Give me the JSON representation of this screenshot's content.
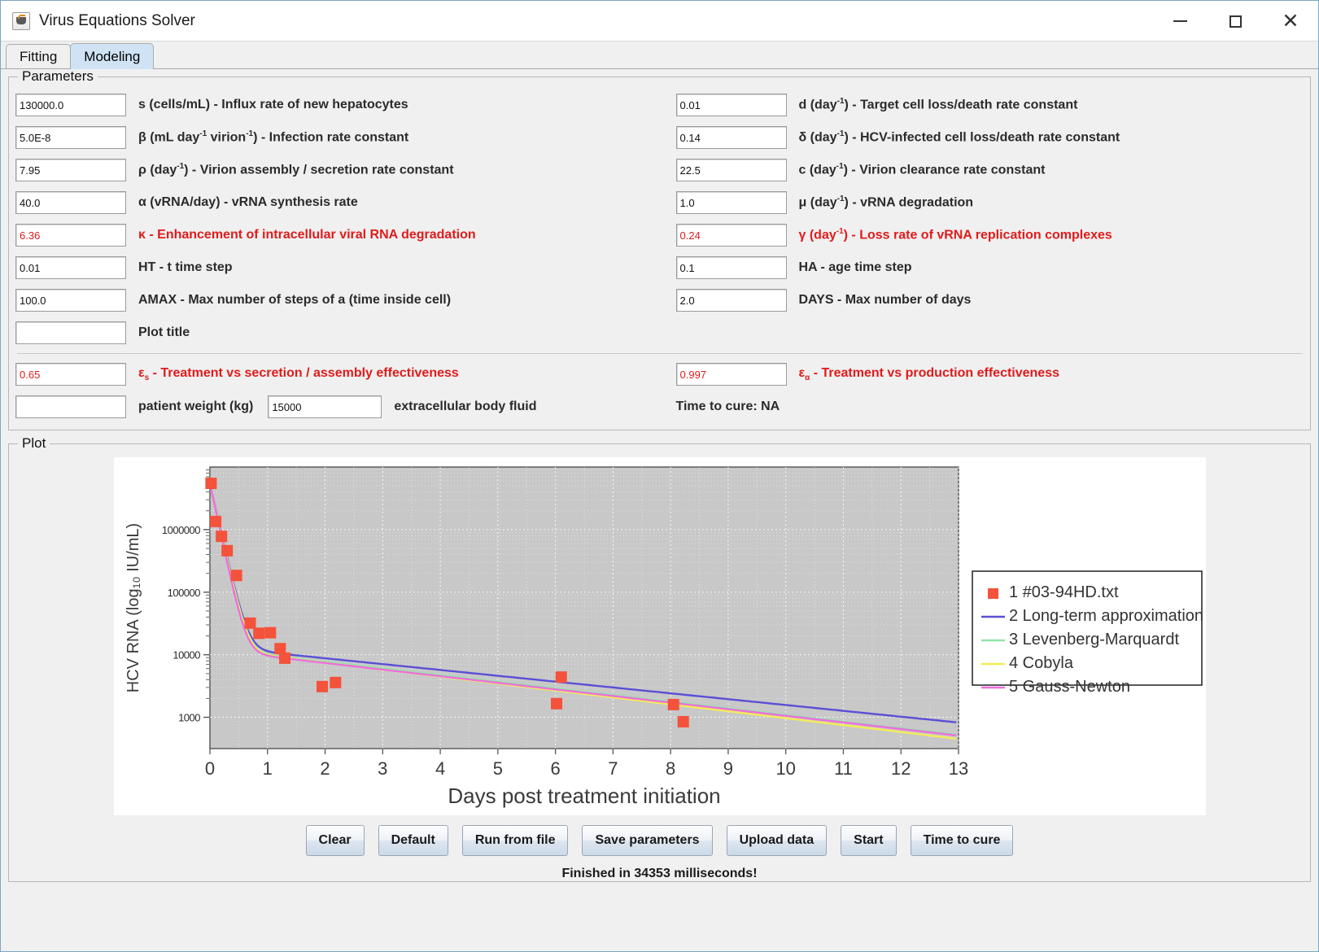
{
  "window": {
    "title": "Virus Equations Solver",
    "icon": "java-coffee-cup-icon",
    "minimize": "—",
    "maximize": "□",
    "close": "✕"
  },
  "tabs": [
    {
      "label": "Fitting",
      "active": false
    },
    {
      "label": "Modeling",
      "active": true
    }
  ],
  "panels": {
    "parameters_title": "Parameters",
    "plot_title": "Plot"
  },
  "parameters": {
    "left": [
      {
        "value": "130000.0",
        "label": "s (cells/mL) - Influx rate of new hepatocytes",
        "red": false
      },
      {
        "value": "5.0E-8",
        "label": "β (mL day⁻¹ virion⁻¹) - Infection rate constant",
        "red": false
      },
      {
        "value": "7.95",
        "label": "ρ (day⁻¹) - Virion assembly / secretion rate constant",
        "red": false
      },
      {
        "value": "40.0",
        "label": "α (vRNA/day) - vRNA synthesis rate",
        "red": false
      },
      {
        "value": "6.36",
        "label": "κ - Enhancement of intracellular viral RNA degradation",
        "red": true
      },
      {
        "value": "0.01",
        "label": "HT - t time step",
        "red": false
      },
      {
        "value": "100.0",
        "label": "AMAX - Max number of steps of a (time inside cell)",
        "red": false
      },
      {
        "value": "",
        "label": "Plot title",
        "red": false
      }
    ],
    "right": [
      {
        "value": "0.01",
        "label": "d (day⁻¹) - Target cell loss/death rate constant",
        "red": false
      },
      {
        "value": "0.14",
        "label": "δ (day⁻¹) - HCV-infected cell loss/death rate constant",
        "red": false
      },
      {
        "value": "22.5",
        "label": "c (day⁻¹) - Virion clearance rate constant",
        "red": false
      },
      {
        "value": "1.0",
        "label": "μ (day⁻¹) - vRNA degradation",
        "red": false
      },
      {
        "value": "0.24",
        "label": "γ (day⁻¹) - Loss rate of vRNA replication complexes",
        "red": true
      },
      {
        "value": "0.1",
        "label": "HA - age time step",
        "red": false
      },
      {
        "value": "2.0",
        "label": "DAYS - Max number of days",
        "red": false
      }
    ],
    "eps_s": {
      "value": "0.65",
      "label": "εs - Treatment vs secretion / assembly effectiveness"
    },
    "eps_a": {
      "value": "0.997",
      "label": "εα - Treatment vs production effectiveness"
    },
    "patient_weight": {
      "value": "",
      "label": "patient weight (kg)"
    },
    "body_fluid": {
      "value": "15000",
      "label": "extracellular body fluid"
    },
    "time_to_cure": "Time to cure: NA"
  },
  "buttons": [
    "Clear",
    "Default",
    "Run from file",
    "Save parameters",
    "Upload data",
    "Start",
    "Time to cure"
  ],
  "status": "Finished in 34353 milliseconds!",
  "chart_data": {
    "type": "scatter",
    "title": "",
    "xlabel": "Days post treatment initiation",
    "ylabel": "HCV RNA (log₁₀ IU/mL)",
    "xlim": [
      0,
      13
    ],
    "ylim_log": [
      2.5,
      7.0
    ],
    "x_ticks": [
      "0",
      "1",
      "2",
      "3",
      "4",
      "5",
      "6",
      "7",
      "8",
      "9",
      "10",
      "11",
      "12",
      "13"
    ],
    "y_ticks": [
      "1000000",
      "100000",
      "10000",
      "1000"
    ],
    "y_tick_values": [
      1000000,
      100000,
      10000,
      1000
    ],
    "grid": true,
    "plot_bg": "#c8c8c8",
    "legend_position": "right",
    "series": [
      {
        "name": "1 #03-94HD.txt",
        "index": 1,
        "type": "scatter",
        "color": "#f4523b",
        "marker": "square",
        "points": [
          {
            "x": 0.02,
            "y": 5500000
          },
          {
            "x": 0.1,
            "y": 1350000
          },
          {
            "x": 0.2,
            "y": 780000
          },
          {
            "x": 0.3,
            "y": 460000
          },
          {
            "x": 0.46,
            "y": 185000
          },
          {
            "x": 0.7,
            "y": 32000
          },
          {
            "x": 0.85,
            "y": 22000
          },
          {
            "x": 1.05,
            "y": 22500
          },
          {
            "x": 1.22,
            "y": 12500
          },
          {
            "x": 1.3,
            "y": 8800
          },
          {
            "x": 1.95,
            "y": 3100
          },
          {
            "x": 2.18,
            "y": 3600
          },
          {
            "x": 6.1,
            "y": 4400
          },
          {
            "x": 6.02,
            "y": 1650
          },
          {
            "x": 8.05,
            "y": 1600
          },
          {
            "x": 8.22,
            "y": 850
          }
        ]
      },
      {
        "name": "2 Long-term approximation",
        "index": 2,
        "type": "line",
        "color": "#5b4fd6"
      },
      {
        "name": "3 Levenberg-Marquardt",
        "index": 3,
        "type": "line",
        "color": "#8fe5a8"
      },
      {
        "name": "4 Cobyla",
        "index": 4,
        "type": "line",
        "color": "#f2ec58"
      },
      {
        "name": "5 Gauss-Newton",
        "index": 5,
        "type": "line",
        "color": "#ee6edd"
      }
    ]
  }
}
